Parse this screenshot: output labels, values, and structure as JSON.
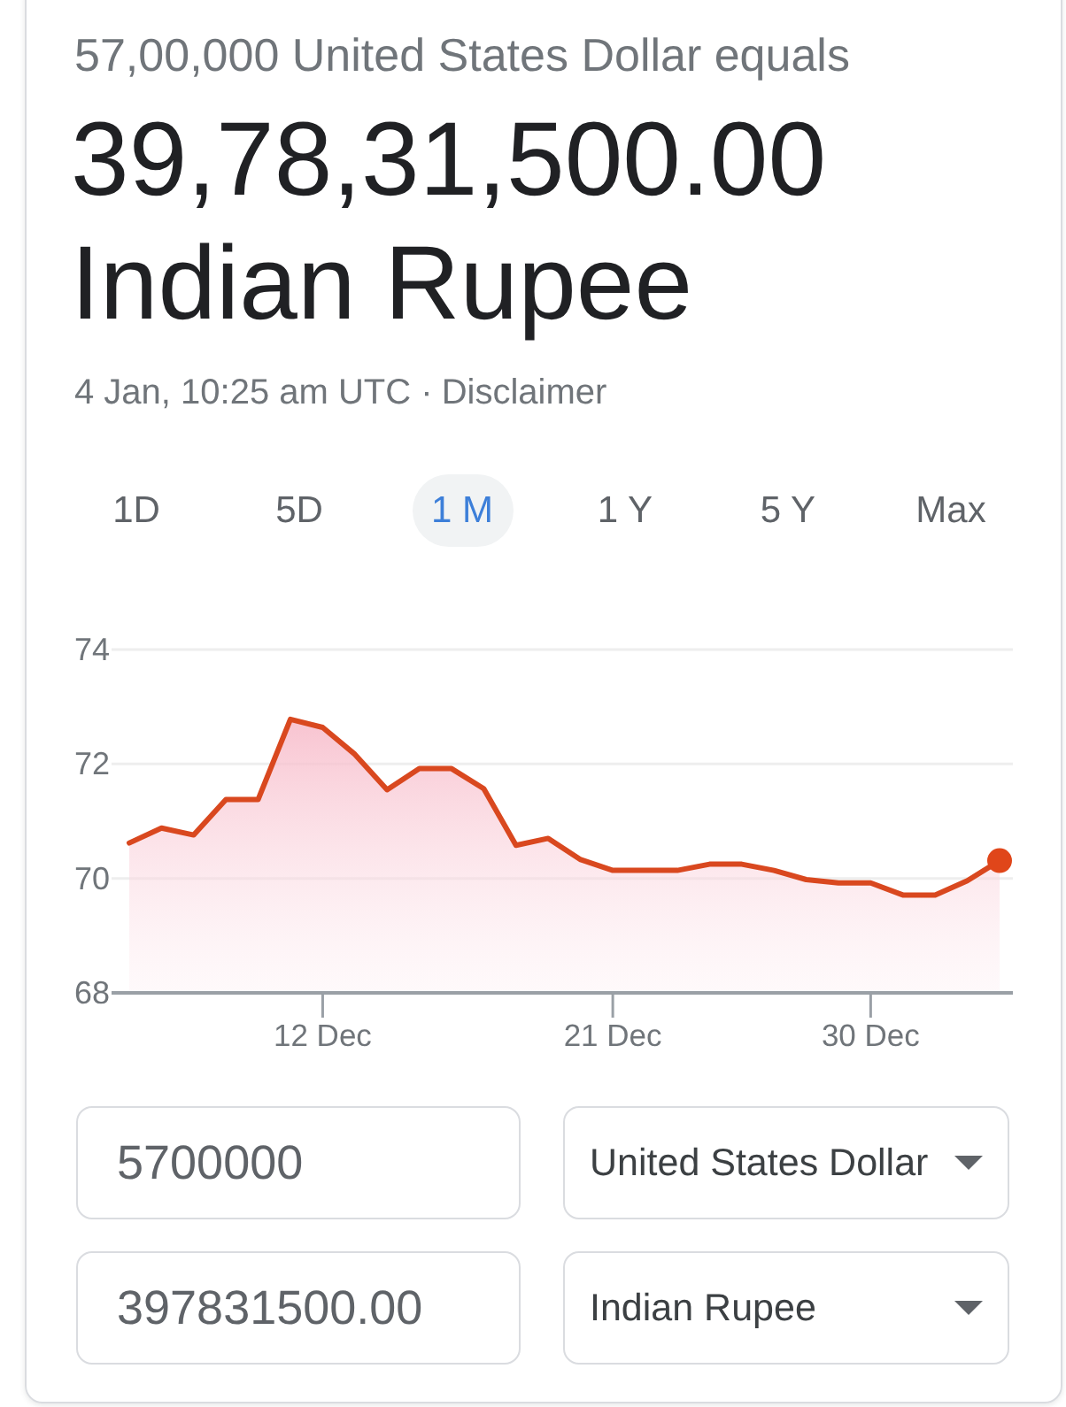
{
  "summary": {
    "source_line": "57,00,000 United States Dollar equals",
    "result_amount": "39,78,31,500.00",
    "result_currency": "Indian Rupee",
    "timestamp": "4 Jan, 10:25 am UTC ·",
    "disclaimer_link": "Disclaimer"
  },
  "ranges": [
    {
      "label": "1D",
      "selected": false
    },
    {
      "label": "5D",
      "selected": false
    },
    {
      "label": "1 M",
      "selected": true
    },
    {
      "label": "1 Y",
      "selected": false
    },
    {
      "label": "5 Y",
      "selected": false
    },
    {
      "label": "Max",
      "selected": false
    }
  ],
  "chart_data": {
    "type": "area",
    "categories": [
      null,
      null,
      null,
      null,
      null,
      null,
      "12 Dec",
      null,
      null,
      null,
      null,
      null,
      null,
      null,
      null,
      "21 Dec",
      null,
      null,
      null,
      null,
      null,
      null,
      null,
      "30 Dec",
      null,
      null,
      null,
      null
    ],
    "values": [
      70.62,
      70.88,
      70.76,
      71.38,
      71.38,
      72.78,
      72.64,
      72.17,
      71.55,
      71.92,
      71.92,
      71.57,
      70.58,
      70.7,
      70.33,
      70.14,
      70.14,
      70.14,
      70.25,
      70.25,
      70.14,
      69.98,
      69.92,
      69.92,
      69.71,
      69.71,
      69.96,
      70.31
    ],
    "ylim": [
      68,
      74
    ],
    "yticks": [
      68,
      70,
      72,
      74
    ]
  },
  "converter": [
    {
      "amount": "5700000",
      "currency": "United States Dollar"
    },
    {
      "amount": "397831500.00",
      "currency": "Indian Rupee"
    }
  ]
}
